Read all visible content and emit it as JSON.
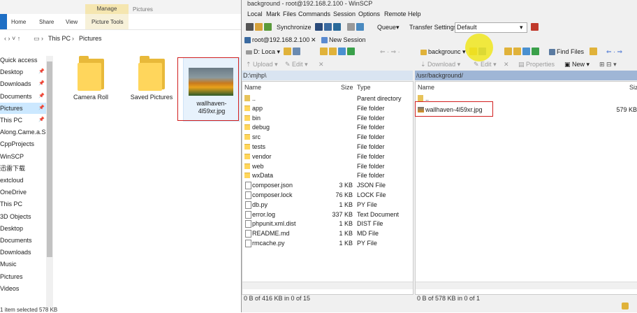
{
  "explorer": {
    "ribbon_tabs": [
      "Home",
      "Share",
      "View",
      "Picture Tools"
    ],
    "manage_label": "Manage",
    "window_title": "Pictures",
    "breadcrumb": [
      "This PC",
      "Pictures"
    ],
    "sidebar": [
      {
        "label": "Quick access",
        "pinned": false,
        "selected": false
      },
      {
        "label": "Desktop",
        "pinned": true,
        "selected": false
      },
      {
        "label": "Downloads",
        "pinned": true,
        "selected": false
      },
      {
        "label": "Documents",
        "pinned": true,
        "selected": false
      },
      {
        "label": "Pictures",
        "pinned": true,
        "selected": true
      },
      {
        "label": "This PC",
        "pinned": true,
        "selected": false
      },
      {
        "label": "Along.Came.a.Sp",
        "pinned": false,
        "selected": false
      },
      {
        "label": "CppProjects",
        "pinned": false,
        "selected": false
      },
      {
        "label": "WinSCP",
        "pinned": false,
        "selected": false
      },
      {
        "label": "迅雷下载",
        "pinned": false,
        "selected": false
      },
      {
        "label": "extcloud",
        "pinned": false,
        "selected": false
      },
      {
        "label": "OneDrive",
        "pinned": false,
        "selected": false
      },
      {
        "label": "This PC",
        "pinned": false,
        "selected": false
      },
      {
        "label": "3D Objects",
        "pinned": false,
        "selected": false
      },
      {
        "label": "Desktop",
        "pinned": false,
        "selected": false
      },
      {
        "label": "Documents",
        "pinned": false,
        "selected": false
      },
      {
        "label": "Downloads",
        "pinned": false,
        "selected": false
      },
      {
        "label": "Music",
        "pinned": false,
        "selected": false
      },
      {
        "label": "Pictures",
        "pinned": false,
        "selected": false
      },
      {
        "label": "Videos",
        "pinned": false,
        "selected": false
      }
    ],
    "items": [
      {
        "label": "Camera Roll",
        "kind": "folder"
      },
      {
        "label": "Saved Pictures",
        "kind": "folder"
      },
      {
        "label": "wallhaven-4l59xr.jpg",
        "kind": "image"
      }
    ],
    "status": "1 item selected  578 KB"
  },
  "winscp": {
    "title": "background - root@192.168.2.100 - WinSCP",
    "menu": [
      "Local",
      "Mark",
      "Files",
      "Commands",
      "Session",
      "Options",
      "Remote",
      "Help"
    ],
    "toolbar": {
      "synchronize": "Synchronize",
      "queue": "Queue",
      "transfer_settings": "Transfer Settings",
      "transfer_profile": "Default"
    },
    "session_tab": "root@192.168.2.100",
    "new_session": "New Session",
    "left_drive": "D: Loca",
    "right_dir_combo": "backgrounc",
    "find_files": "Find Files",
    "left_actions": [
      "Upload",
      "Edit"
    ],
    "right_actions": [
      "Download",
      "Edit",
      "Properties",
      "New"
    ],
    "left_path": "D:\\mjhp\\",
    "right_path": "/usr/background/",
    "left_columns": [
      "Name",
      "Size",
      "Type"
    ],
    "right_columns": [
      "Name",
      "Size"
    ],
    "left_files": [
      {
        "name": "..",
        "size": "",
        "type": "Parent directory",
        "icon": "up"
      },
      {
        "name": "app",
        "size": "",
        "type": "File folder",
        "icon": "folder"
      },
      {
        "name": "bin",
        "size": "",
        "type": "File folder",
        "icon": "folder"
      },
      {
        "name": "debug",
        "size": "",
        "type": "File folder",
        "icon": "folder"
      },
      {
        "name": "src",
        "size": "",
        "type": "File folder",
        "icon": "folder"
      },
      {
        "name": "tests",
        "size": "",
        "type": "File folder",
        "icon": "folder"
      },
      {
        "name": "vendor",
        "size": "",
        "type": "File folder",
        "icon": "folder"
      },
      {
        "name": "web",
        "size": "",
        "type": "File folder",
        "icon": "folder"
      },
      {
        "name": "wxData",
        "size": "",
        "type": "File folder",
        "icon": "folder"
      },
      {
        "name": "composer.json",
        "size": "3 KB",
        "type": "JSON File",
        "icon": "doc"
      },
      {
        "name": "composer.lock",
        "size": "76 KB",
        "type": "LOCK File",
        "icon": "doc"
      },
      {
        "name": "db.py",
        "size": "1 KB",
        "type": "PY File",
        "icon": "doc"
      },
      {
        "name": "error.log",
        "size": "337 KB",
        "type": "Text Document",
        "icon": "doc"
      },
      {
        "name": "phpunit.xml.dist",
        "size": "1 KB",
        "type": "DIST File",
        "icon": "doc"
      },
      {
        "name": "README.md",
        "size": "1 KB",
        "type": "MD File",
        "icon": "doc"
      },
      {
        "name": "rmcache.py",
        "size": "1 KB",
        "type": "PY File",
        "icon": "doc"
      }
    ],
    "right_files": [
      {
        "name": "..",
        "size": "",
        "icon": "up"
      },
      {
        "name": "wallhaven-4l59xr.jpg",
        "size": "579 KB",
        "icon": "image"
      }
    ],
    "left_status": "0 B of 416 KB in 0 of 15",
    "right_status": "0 B of 578 KB in 0 of 1"
  }
}
